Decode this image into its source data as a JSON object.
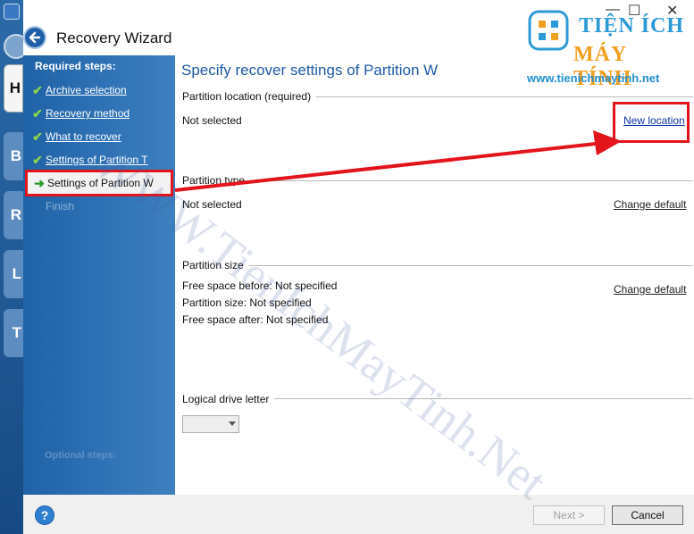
{
  "window": {
    "title": "Recovery Wizard"
  },
  "background_tabs": [
    "H",
    "B",
    "R",
    "L",
    "T"
  ],
  "sidebar": {
    "heading": "Required steps:",
    "steps": [
      {
        "label": "Archive selection",
        "state": "done"
      },
      {
        "label": "Recovery method",
        "state": "done"
      },
      {
        "label": "What to recover",
        "state": "done"
      },
      {
        "label": "Settings of Partition T",
        "state": "done"
      },
      {
        "label": "Settings of Partition W",
        "state": "current"
      },
      {
        "label": "Finish",
        "state": "disabled"
      }
    ],
    "optional_heading": "Optional steps:"
  },
  "main": {
    "title": "Specify recover settings of Partition W",
    "location": {
      "header": "Partition location (required)",
      "value": "Not selected",
      "action": "New location"
    },
    "type": {
      "header": "Partition type",
      "value": "Not selected",
      "action": "Change default"
    },
    "size": {
      "header": "Partition size",
      "lines": [
        "Free space before: Not specified",
        "Partition size: Not specified",
        "Free space after: Not specified"
      ],
      "action": "Change default"
    },
    "drive": {
      "header": "Logical drive letter",
      "selected": ""
    }
  },
  "footer": {
    "next_label": "Next >",
    "cancel_label": "Cancel"
  },
  "watermark": "WWW.TienIchMayTinh.Net",
  "logo": {
    "line1": "TIỆN ÍCH",
    "line2": "MÁY TÍNH",
    "url": "www.tienichmaytinh.net"
  },
  "colors": {
    "accent": "#1e5aa8",
    "highlight": "#e4141b",
    "sidebar": "#2f73b6",
    "check": "#8bd34a"
  }
}
